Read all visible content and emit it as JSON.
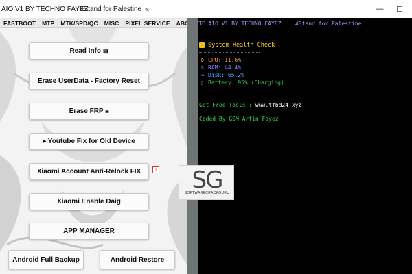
{
  "window": {
    "title": "AIO V1 BY TECHNO FAYEZ",
    "subtitle": "#Stand for Palestine",
    "subtitle_tag": "PS",
    "minimize_glyph": "—",
    "maximize_glyph": "☐"
  },
  "menu": [
    "FASTBOOT",
    "MTP",
    "MTK/SPD/QC",
    "MISC",
    "PIXEL SERVICE",
    "ABOUT"
  ],
  "buttons": {
    "read_info": "Read Info",
    "erase_userdata": "Erase UserData - Factory Reset",
    "erase_frp": "Erase FRP",
    "youtube_fix": "▸ Youtube Fix for Old Device",
    "xiaomi_antirelock": "Xiaomi Account Anti-Relock FIX",
    "xiaomi_diag": "Xiaomi Enable Daig",
    "app_manager": "APP MANAGER",
    "android_backup": "Android Full Backup",
    "android_restore": "Android Restore"
  },
  "watermark": {
    "logo": "SG",
    "text": "SOFTWARECRACKGURU"
  },
  "console": {
    "title": "TF AIO V1 BY TECHNO FAYEZ",
    "tag": "#Stand for Palestine",
    "health_heading": "System Health Check",
    "cpu": "CPU: 11.6%",
    "ram": "RAM: 44.4%",
    "disk": "Disk: 65.2%",
    "battery": "Battery: 95% (Charging)",
    "free_tools_label": "Get Free Tools : ",
    "free_tools_link": "www.tfbd24.xyz",
    "coded_by": "Coded By GSM Arfin Fayez"
  },
  "colors": {
    "console_bg": "#000000",
    "console_purple": "#b08cff",
    "console_green": "#3bcf4e",
    "console_yellow": "#f5d21b",
    "cpu_orange": "#ff9a2e",
    "disk_blue": "#4db0ff"
  },
  "icons": {
    "read_info": "document-icon",
    "erase_frp": "camera-icon",
    "info": "info-icon",
    "cpu": "cpu-icon",
    "ram": "ram-icon",
    "disk": "disk-icon",
    "battery": "battery-icon"
  }
}
